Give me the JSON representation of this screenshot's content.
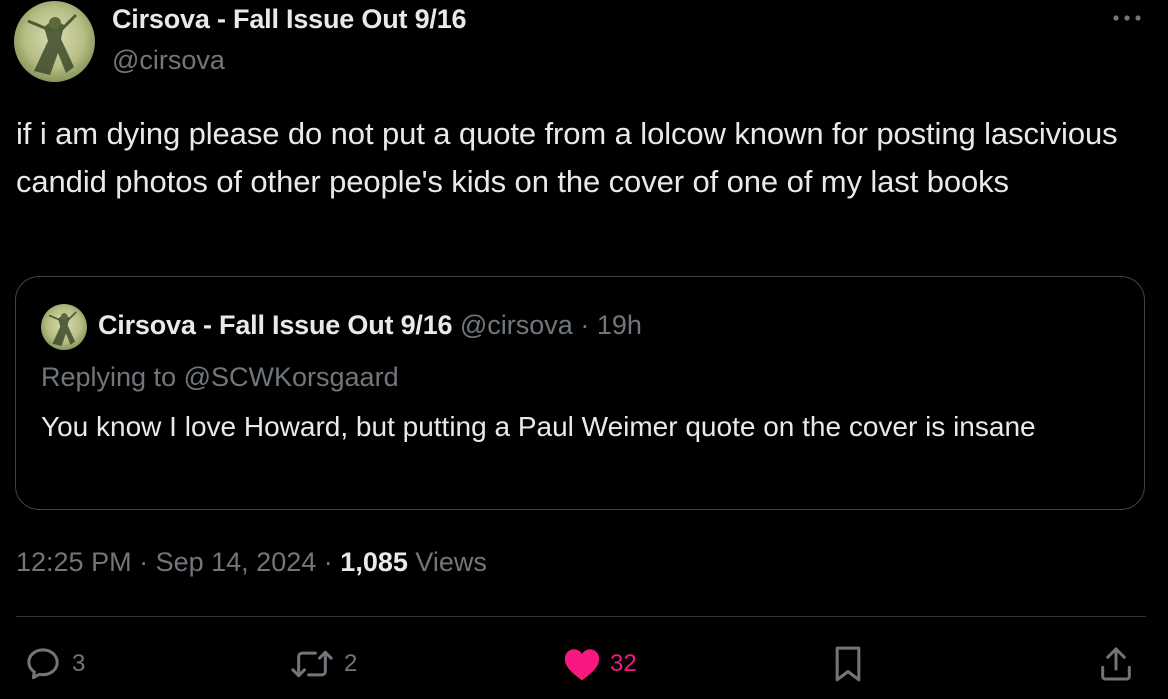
{
  "post": {
    "author_name": "Cirsova - Fall Issue Out 9/16",
    "author_handle": "@cirsova",
    "more_icon": "ellipsis-icon",
    "text": "if i am dying please do not put a quote from a lolcow known for posting lascivious candid photos of other people's kids on the cover of one of my last books"
  },
  "quote": {
    "author_name": "Cirsova - Fall Issue Out 9/16",
    "author_handle": "@cirsova",
    "separator": "·",
    "age": "19h",
    "replying_prefix": "Replying to",
    "replying_to": "@SCWKorsgaard",
    "text": "You know I love Howard, but putting a Paul Weimer quote on the cover is insane"
  },
  "meta": {
    "time": "12:25 PM",
    "sep1": "·",
    "date": "Sep 14, 2024",
    "sep2": "·",
    "views_count": "1,085",
    "views_label": "Views"
  },
  "actions": {
    "replies": "3",
    "reposts": "2",
    "likes": "32",
    "like_color": "#f91880",
    "icons": [
      "reply-icon",
      "repost-icon",
      "like-icon",
      "bookmark-icon",
      "share-icon"
    ]
  }
}
